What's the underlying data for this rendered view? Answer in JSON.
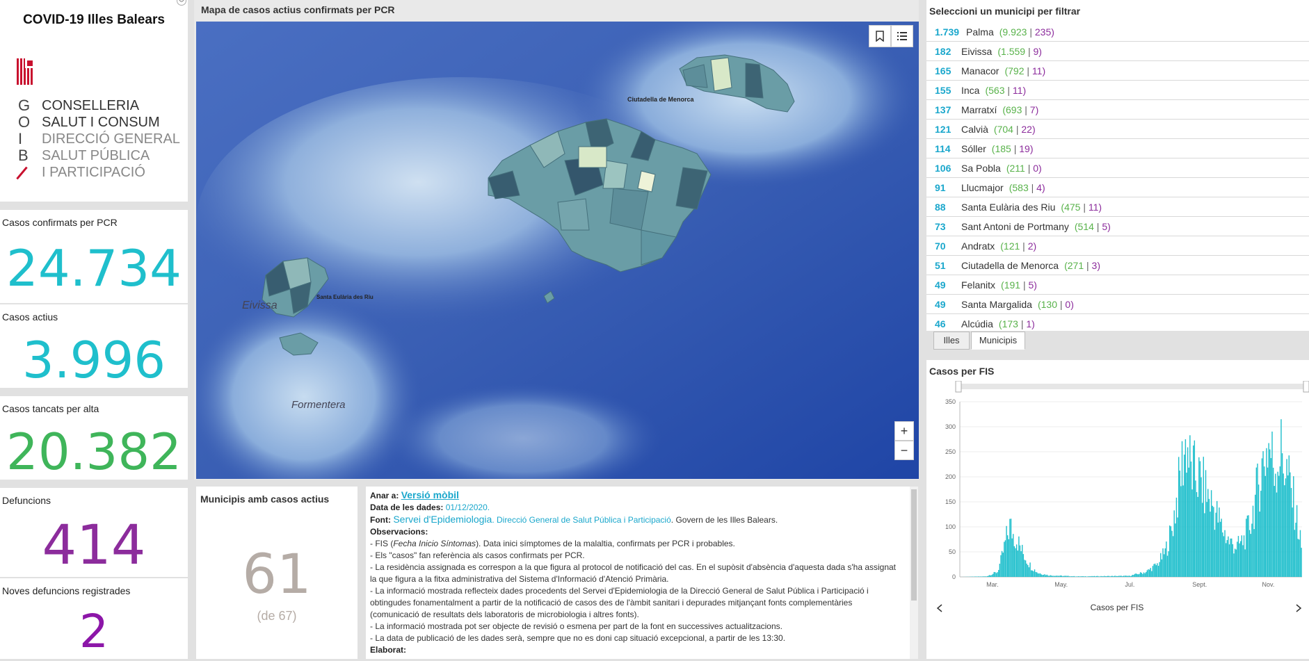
{
  "header": {
    "title": "COVID-19 Illes Balears",
    "logo_letters": [
      "G",
      "O",
      "I",
      "B"
    ],
    "logo_lines": [
      "CONSELLERIA",
      "SALUT I CONSUM",
      "DIRECCIÓ GENERAL",
      "SALUT PÚBLICA",
      "I PARTICIPACIÓ"
    ],
    "flag_red": "#c8102e"
  },
  "kpis": {
    "confirmed": {
      "label": "Casos confirmats per PCR",
      "value": "24.734",
      "color": "#1fbfcc"
    },
    "active": {
      "label": "Casos actius",
      "value": "3.996",
      "color": "#1fbfcc"
    },
    "closed": {
      "label": "Casos tancats per alta",
      "value": "20.382",
      "color": "#3fb55a"
    },
    "deaths": {
      "label": "Defuncions",
      "value": "414",
      "color": "#8c2c9c"
    },
    "new_deaths": {
      "label": "Noves defuncions registrades",
      "value": "2",
      "color": "#8c16a8"
    }
  },
  "map": {
    "title": "Mapa de casos actius confirmats per PCR",
    "label_ciutadella": "Ciutadella de Menorca",
    "label_santa_eularia": "Santa Eulària des Riu",
    "label_eivissa": "Eivissa",
    "label_formentera": "Formentera",
    "zoom_in": "+",
    "zoom_out": "−",
    "sea_color": "#3a5fb4",
    "land_color": "#6a9da6"
  },
  "municipalities": {
    "title": "Municipis amb casos actius",
    "value": "61",
    "of_total": "(de 67)"
  },
  "filter": {
    "title": "Seleccioni un municipi per filtrar",
    "items": [
      {
        "active": "1.739",
        "name": "Palma",
        "confirmed": "9.923",
        "deaths": "235"
      },
      {
        "active": "182",
        "name": "Eivissa",
        "confirmed": "1.559",
        "deaths": "9"
      },
      {
        "active": "165",
        "name": "Manacor",
        "confirmed": "792",
        "deaths": "11"
      },
      {
        "active": "155",
        "name": "Inca",
        "confirmed": "563",
        "deaths": "11"
      },
      {
        "active": "137",
        "name": "Marratxí",
        "confirmed": "693",
        "deaths": "7"
      },
      {
        "active": "121",
        "name": "Calvià",
        "confirmed": "704",
        "deaths": "22"
      },
      {
        "active": "114",
        "name": "Sóller",
        "confirmed": "185",
        "deaths": "19"
      },
      {
        "active": "106",
        "name": "Sa Pobla",
        "confirmed": "211",
        "deaths": "0"
      },
      {
        "active": "91",
        "name": "Llucmajor",
        "confirmed": "583",
        "deaths": "4"
      },
      {
        "active": "88",
        "name": "Santa Eulària des Riu",
        "confirmed": "475",
        "deaths": "11"
      },
      {
        "active": "73",
        "name": "Sant Antoni de Portmany",
        "confirmed": "514",
        "deaths": "5"
      },
      {
        "active": "70",
        "name": "Andratx",
        "confirmed": "121",
        "deaths": "2"
      },
      {
        "active": "51",
        "name": "Ciutadella de Menorca",
        "confirmed": "271",
        "deaths": "3"
      },
      {
        "active": "49",
        "name": "Felanitx",
        "confirmed": "191",
        "deaths": "5"
      },
      {
        "active": "49",
        "name": "Santa Margalida",
        "confirmed": "130",
        "deaths": "0"
      },
      {
        "active": "46",
        "name": "Alcúdia",
        "confirmed": "173",
        "deaths": "1"
      }
    ],
    "tabs": [
      "Illes",
      "Municipis"
    ]
  },
  "notes": {
    "go_to_label": "Anar a:",
    "go_to_link": "Versió mòbil",
    "date_label": "Data de les dades:",
    "date_value": "01/12/2020.",
    "source_label": "Font:",
    "source_service": "Servei d'Epidemiologia",
    "source_dg": ". Direcció General de Salut Pública i Participació",
    "source_govern": ". Govern de les Illes Balears.",
    "obs_label": "Observacions:",
    "fis_prefix": "- FIS (",
    "fis_italic": "Fecha Inicio Síntomas",
    "fis_rest": "). Data inici símptomes de la malaltia, confirmats per PCR i probables.",
    "lines": [
      "- Els \"casos\" fan referència als casos confirmats per PCR.",
      "- La residència assignada es correspon a la que figura al protocol de notificació del cas. En el supòsit d'absència d'aquesta dada s'ha assignat",
      "la que figura a la fitxa administrativa del Sistema d'Informació d'Atenció Primària.",
      "- La informació mostrada reflecteix dades procedents del Servei d'Epidemiologia de la Direcció General de Salut Pública i Participació i",
      "obtingudes fonamentalment a partir de la notificació de casos des de l'àmbit sanitari i depurades mitjançant fonts complementàries",
      "(comunicació de resultats dels laboratoris de microbiologia i altres fonts).",
      "- La informació mostrada pot ser objecte de revisió o esmena per part de la font en successives actualitzacions.",
      "- La data de publicació de les dades serà, sempre que no es doni cap situació excepcional, a partir de les 13:30."
    ],
    "elaborat_label": "Elaborat:"
  },
  "chart_data": {
    "type": "bar",
    "title": "Casos per FIS",
    "xlabel": "Casos per FIS",
    "ylabel": "",
    "ylim": [
      0,
      350
    ],
    "yticks": [
      0,
      50,
      100,
      150,
      200,
      250,
      300,
      350
    ],
    "xtick_labels": [
      "Mar.",
      "May.",
      "Jul.",
      "Sept.",
      "Nov."
    ],
    "bar_color": "#1fbfcc",
    "grid": true,
    "x_start": "2020-02-01",
    "x_end": "2020-12-01",
    "xtick_dates": [
      "2020-03-01",
      "2020-05-01",
      "2020-07-01",
      "2020-09-01",
      "2020-11-01"
    ],
    "series_keypoints": [
      [
        "2020-02-01",
        0
      ],
      [
        "2020-02-24",
        1
      ],
      [
        "2020-03-05",
        10
      ],
      [
        "2020-03-09",
        40
      ],
      [
        "2020-03-13",
        78
      ],
      [
        "2020-03-16",
        102
      ],
      [
        "2020-03-19",
        85
      ],
      [
        "2020-03-23",
        72
      ],
      [
        "2020-03-26",
        55
      ],
      [
        "2020-03-30",
        38
      ],
      [
        "2020-04-04",
        20
      ],
      [
        "2020-04-10",
        8
      ],
      [
        "2020-04-20",
        3
      ],
      [
        "2020-05-15",
        1
      ],
      [
        "2020-06-30",
        2
      ],
      [
        "2020-07-15",
        10
      ],
      [
        "2020-07-25",
        25
      ],
      [
        "2020-08-01",
        50
      ],
      [
        "2020-08-07",
        95
      ],
      [
        "2020-08-13",
        180
      ],
      [
        "2020-08-17",
        240
      ],
      [
        "2020-08-20",
        270
      ],
      [
        "2020-08-24",
        210
      ],
      [
        "2020-08-30",
        200
      ],
      [
        "2020-09-06",
        170
      ],
      [
        "2020-09-13",
        140
      ],
      [
        "2020-09-20",
        100
      ],
      [
        "2020-09-27",
        70
      ],
      [
        "2020-10-04",
        60
      ],
      [
        "2020-10-10",
        75
      ],
      [
        "2020-10-16",
        110
      ],
      [
        "2020-10-22",
        175
      ],
      [
        "2020-10-27",
        230
      ],
      [
        "2020-11-01",
        265
      ],
      [
        "2020-11-06",
        220
      ],
      [
        "2020-11-12",
        250
      ],
      [
        "2020-11-18",
        200
      ],
      [
        "2020-11-24",
        140
      ],
      [
        "2020-11-30",
        60
      ]
    ]
  }
}
